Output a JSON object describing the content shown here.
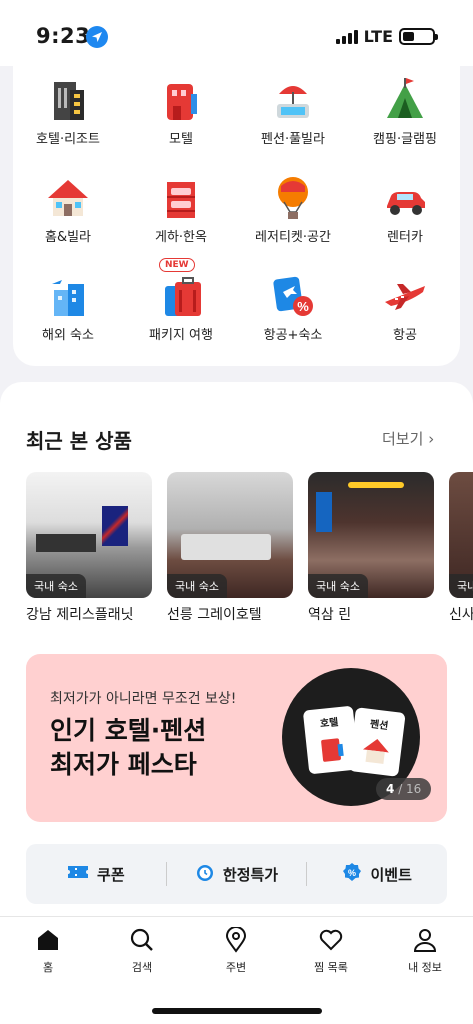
{
  "status": {
    "time": "9:23",
    "network": "LTE"
  },
  "categories": [
    {
      "label": "호텔·리조트",
      "icon": "hotel-icon"
    },
    {
      "label": "모텔",
      "icon": "motel-icon"
    },
    {
      "label": "펜션·풀빌라",
      "icon": "pension-icon"
    },
    {
      "label": "캠핑·글램핑",
      "icon": "camping-icon"
    },
    {
      "label": "홈&빌라",
      "icon": "home-villa-icon"
    },
    {
      "label": "게하·한옥",
      "icon": "guesthouse-icon"
    },
    {
      "label": "레저티켓·공간",
      "icon": "leisure-icon"
    },
    {
      "label": "렌터카",
      "icon": "rentacar-icon"
    },
    {
      "label": "해외 숙소",
      "icon": "overseas-icon"
    },
    {
      "label": "패키지 여행",
      "icon": "package-icon",
      "badge": "NEW"
    },
    {
      "label": "항공+숙소",
      "icon": "flight-hotel-icon"
    },
    {
      "label": "항공",
      "icon": "flight-icon"
    }
  ],
  "recent": {
    "title": "최근 본 상품",
    "more": "더보기",
    "items": [
      {
        "tag": "국내 숙소",
        "name": "강남 제리스플래닛"
      },
      {
        "tag": "국내 숙소",
        "name": "선릉 그레이호텔"
      },
      {
        "tag": "국내 숙소",
        "name": "역삼 린"
      },
      {
        "tag": "국내",
        "name": "신사"
      }
    ]
  },
  "banner": {
    "sub": "최저가가 아니라면 무조건 보상!",
    "line1": "인기 호텔·펜션",
    "line2": "최저가 페스타",
    "card_a": "호텔",
    "card_b": "펜션",
    "page": "4",
    "total": "/ 16"
  },
  "quick": [
    {
      "label": "쿠폰",
      "icon": "coupon-icon"
    },
    {
      "label": "한정특가",
      "icon": "alarm-icon"
    },
    {
      "label": "이벤트",
      "icon": "event-badge-icon"
    }
  ],
  "tabs": [
    {
      "label": "홈",
      "icon": "home-icon"
    },
    {
      "label": "검색",
      "icon": "search-icon"
    },
    {
      "label": "주변",
      "icon": "location-pin-icon"
    },
    {
      "label": "찜 목록",
      "icon": "heart-icon"
    },
    {
      "label": "내 정보",
      "icon": "person-icon"
    }
  ]
}
